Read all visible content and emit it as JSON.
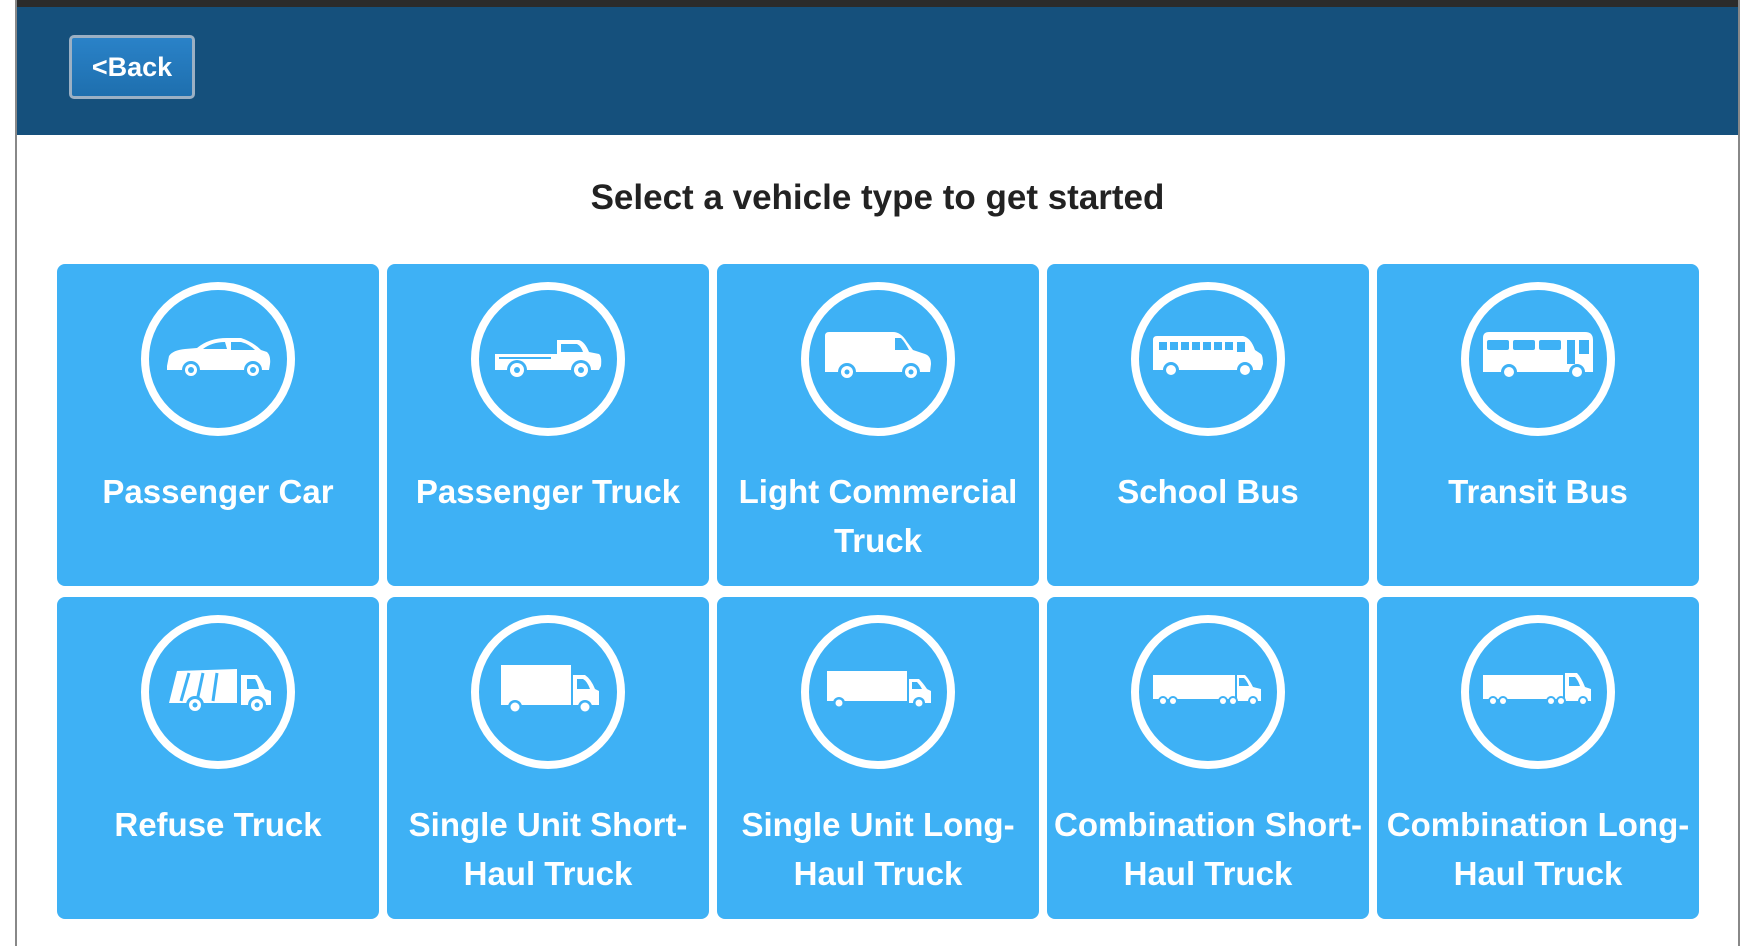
{
  "header": {
    "back_label": "<Back"
  },
  "main": {
    "title": "Select a vehicle type to get started"
  },
  "vehicles": [
    {
      "label": "Passenger Car",
      "icon": "car-icon"
    },
    {
      "label": "Passenger Truck",
      "icon": "pickup-truck-icon"
    },
    {
      "label": "Light Commercial Truck",
      "icon": "van-icon"
    },
    {
      "label": "School Bus",
      "icon": "school-bus-icon"
    },
    {
      "label": "Transit Bus",
      "icon": "transit-bus-icon"
    },
    {
      "label": "Refuse Truck",
      "icon": "refuse-truck-icon"
    },
    {
      "label": "Single Unit Short-Haul Truck",
      "icon": "box-truck-icon"
    },
    {
      "label": "Single Unit Long-Haul Truck",
      "icon": "box-truck-long-icon"
    },
    {
      "label": "Combination Short-Haul Truck",
      "icon": "semi-truck-icon"
    },
    {
      "label": "Combination Long-Haul Truck",
      "icon": "semi-truck-long-icon"
    }
  ],
  "colors": {
    "header": "#15507c",
    "tile": "#3eb1f5",
    "title_text": "#222222"
  }
}
